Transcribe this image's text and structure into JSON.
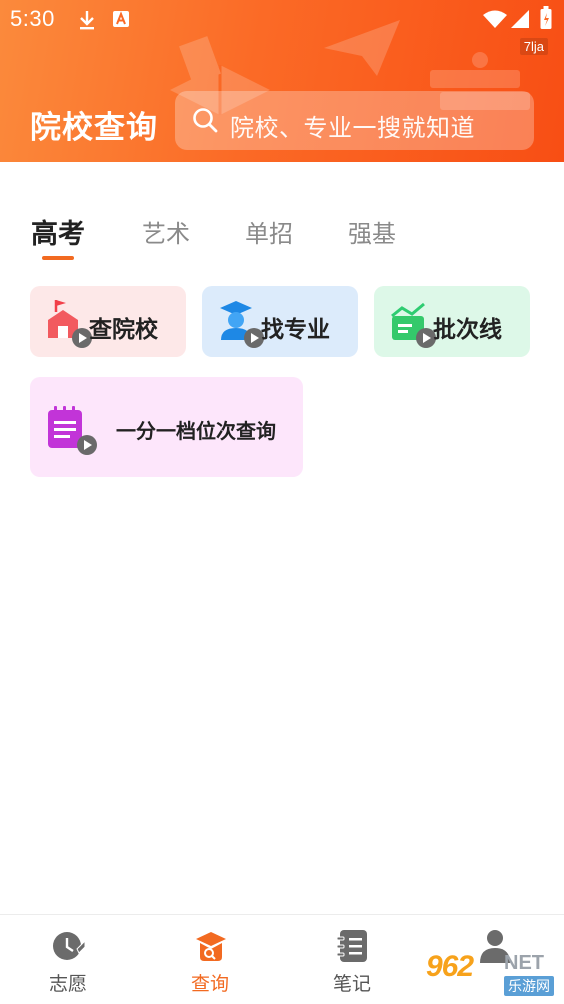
{
  "status_bar": {
    "time": "5:30",
    "tag": "7lja",
    "icons": [
      "download-icon",
      "app-a-icon",
      "wifi-icon",
      "signal-icon",
      "battery-icon"
    ]
  },
  "header": {
    "title": "院校查询",
    "search_placeholder": "院校、专业一搜就知道"
  },
  "tabs": [
    {
      "label": "高考",
      "active": true
    },
    {
      "label": "艺术",
      "active": false
    },
    {
      "label": "单招",
      "active": false
    },
    {
      "label": "强基",
      "active": false
    }
  ],
  "features": [
    {
      "label": "查院校",
      "icon": "school-icon",
      "bg": "#fde8e8"
    },
    {
      "label": "找专业",
      "icon": "graduate-icon",
      "bg": "#dcebfb"
    },
    {
      "label": "批次线",
      "icon": "chart-line-icon",
      "bg": "#ddf8e8"
    },
    {
      "label": "一分一档位次查询",
      "icon": "notepad-icon",
      "bg": "#fde6fb"
    }
  ],
  "bottom_nav": [
    {
      "label": "志愿",
      "icon": "volunteer-icon",
      "active": false
    },
    {
      "label": "查询",
      "icon": "query-icon",
      "active": true
    },
    {
      "label": "笔记",
      "icon": "notebook-icon",
      "active": false
    },
    {
      "label": "",
      "icon": "profile-icon",
      "active": false
    }
  ],
  "watermark": {
    "number": "962",
    "suffix": "NET",
    "name": "乐游网"
  },
  "colors": {
    "accent": "#f26a21",
    "header_start": "#fb8a3c",
    "header_end": "#f84e14"
  }
}
